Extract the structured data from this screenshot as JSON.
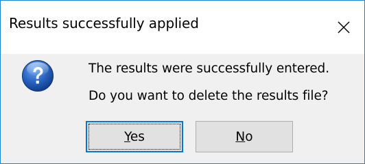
{
  "dialog": {
    "title": "Results successfully applied",
    "close_icon": "close-icon",
    "message_icon": "question-icon",
    "message_line1": "The results were successfully entered.",
    "message_line2": "Do you want to delete the results file?",
    "buttons": {
      "yes": {
        "mnemonic": "Y",
        "rest": "es"
      },
      "no": {
        "mnemonic": "N",
        "rest": "o"
      }
    }
  },
  "colors": {
    "frame_border": "#1883d7",
    "client_background": "#f0f0f0",
    "title_background": "#ffffff",
    "button_face": "#e1e1e1",
    "default_button_border": "#0078d7",
    "icon_blue": "#1f5fb8"
  }
}
